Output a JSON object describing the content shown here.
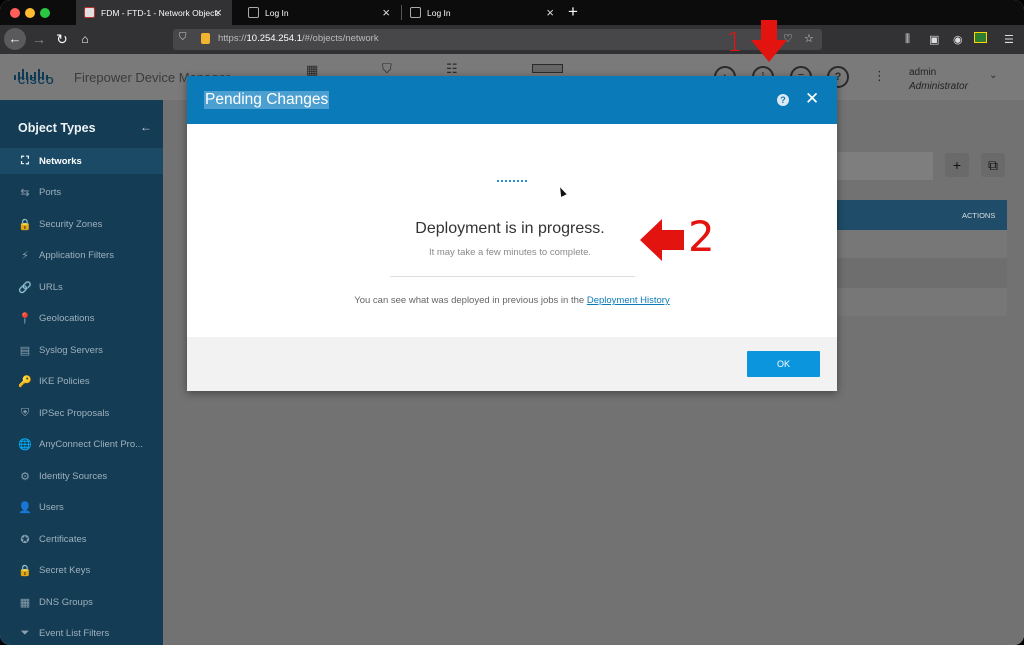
{
  "browser": {
    "tabs": [
      {
        "label": "FDM - FTD-1 - Network Objects",
        "active": true
      },
      {
        "label": "Log In",
        "active": false
      },
      {
        "label": "Log In",
        "active": false
      }
    ],
    "url_prefix": "https://",
    "url_host": "10.254.254.1",
    "url_path": "/#/objects/network"
  },
  "app": {
    "brand": "CISCO",
    "title": "Firepower Device Manager",
    "user_name": "admin",
    "user_role": "Administrator",
    "header_help_glyph": "?"
  },
  "sidebar": {
    "title": "Object Types",
    "items": [
      {
        "label": "Networks",
        "icon": "network-icon",
        "glyph": "⛶",
        "active": true
      },
      {
        "label": "Ports",
        "icon": "ports-icon",
        "glyph": "⇆"
      },
      {
        "label": "Security Zones",
        "icon": "lock-icon",
        "glyph": "🔒"
      },
      {
        "label": "Application Filters",
        "icon": "filter-icon",
        "glyph": "⚡"
      },
      {
        "label": "URLs",
        "icon": "link-icon",
        "glyph": "🔗"
      },
      {
        "label": "Geolocations",
        "icon": "location-icon",
        "glyph": "📍"
      },
      {
        "label": "Syslog Servers",
        "icon": "server-icon",
        "glyph": "▤"
      },
      {
        "label": "IKE Policies",
        "icon": "key-icon",
        "glyph": "🔑"
      },
      {
        "label": "IPSec Proposals",
        "icon": "shield-icon",
        "glyph": "⛨"
      },
      {
        "label": "AnyConnect Client Pro...",
        "icon": "globe-icon",
        "glyph": "🌐"
      },
      {
        "label": "Identity Sources",
        "icon": "identity-icon",
        "glyph": "⚙"
      },
      {
        "label": "Users",
        "icon": "user-icon",
        "glyph": "👤"
      },
      {
        "label": "Certificates",
        "icon": "certificate-icon",
        "glyph": "✪"
      },
      {
        "label": "Secret Keys",
        "icon": "lock-icon",
        "glyph": "🔒"
      },
      {
        "label": "DNS Groups",
        "icon": "dns-icon",
        "glyph": "▦"
      },
      {
        "label": "Event List Filters",
        "icon": "funnel-icon",
        "glyph": "⏷"
      }
    ]
  },
  "main": {
    "actions_header": "ACTIONS",
    "add_glyph": "+"
  },
  "modal": {
    "title": "Pending Changes",
    "help_glyph": "?",
    "close_glyph": "✕",
    "deploy_title": "Deployment is in progress.",
    "deploy_subtitle": "It may take a few minutes to complete.",
    "history_text": "You can see what was deployed in previous jobs in the",
    "history_link": "Deployment History",
    "ok_label": "OK"
  },
  "annotations": {
    "label_1": "1",
    "label_2": "2",
    "color": "#e3140f"
  },
  "colors": {
    "modal_header": "#0b7ab8",
    "sidebar_bg": "#143c55",
    "ok_button": "#0b95dd"
  }
}
